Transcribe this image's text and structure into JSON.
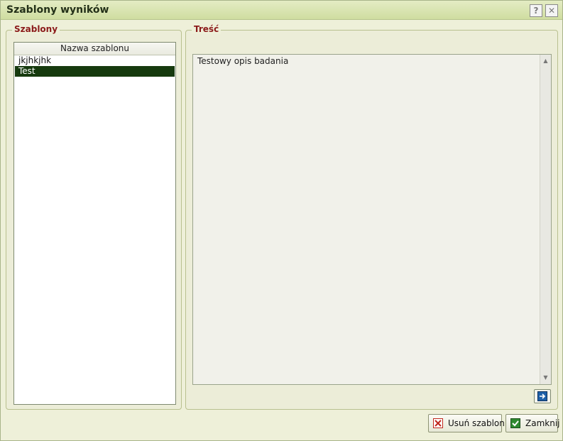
{
  "window": {
    "title": "Szablony wyników",
    "help_glyph": "?",
    "close_glyph": "✕"
  },
  "templates_group": {
    "legend": "Szablony",
    "column_header": "Nazwa szablonu",
    "items": [
      {
        "label": "jkjhkjhk"
      },
      {
        "label": "Test"
      }
    ],
    "selected_index": 1
  },
  "content_group": {
    "legend": "Treść",
    "text": "Testowy opis badania"
  },
  "footer": {
    "delete_label": "Usuń szablon",
    "close_label": "Zamknij"
  },
  "colors": {
    "selection": "#163a0e",
    "legend_text": "#8b1a1a",
    "background": "#eef0d9"
  },
  "icons": {
    "insert": "arrow-right-icon",
    "delete": "x-icon",
    "close": "check-icon"
  }
}
